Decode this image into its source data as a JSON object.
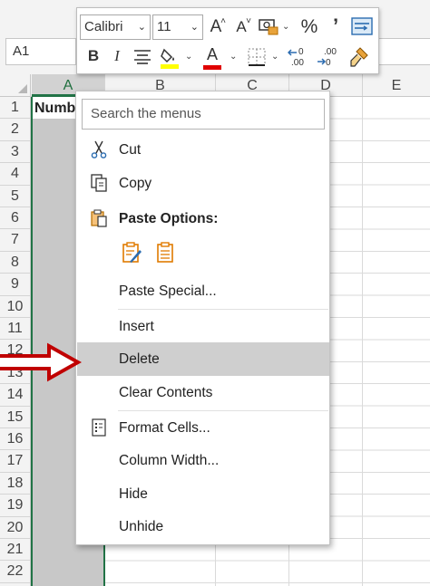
{
  "formula_bar": {
    "name_box": "A1"
  },
  "mini_toolbar": {
    "font_name": "Calibri",
    "font_size": "11",
    "increase_font_label": "A",
    "decrease_font_label": "A",
    "percent_label": "%",
    "comma_label": "ʕ",
    "bold_label": "B",
    "italic_label": "I",
    "font_color_label": "A",
    "font_color": "#e00000",
    "fill_color": "#ffff00",
    "inc_decimal_label": ".00",
    "dec_decimal_label": ".00"
  },
  "grid": {
    "columns": [
      "A",
      "B",
      "C",
      "D",
      "E"
    ],
    "rows": [
      "1",
      "2",
      "3",
      "4",
      "5",
      "6",
      "7",
      "8",
      "9",
      "10",
      "11",
      "12",
      "13",
      "14",
      "15",
      "16",
      "17",
      "18",
      "19",
      "20",
      "21",
      "22"
    ],
    "a1_value": "Number"
  },
  "context_menu": {
    "search_placeholder": "Search the menus",
    "items": {
      "cut": "Cut",
      "copy": "Copy",
      "paste_options": "Paste Options:",
      "paste_special": "Paste Special...",
      "insert": "Insert",
      "delete": "Delete",
      "clear_contents": "Clear Contents",
      "format_cells": "Format Cells...",
      "column_width": "Column Width...",
      "hide": "Hide",
      "unhide": "Unhide"
    }
  },
  "colors": {
    "excel_green": "#217346",
    "arrow_red": "#c00000",
    "paste_orange": "#e07b00"
  }
}
